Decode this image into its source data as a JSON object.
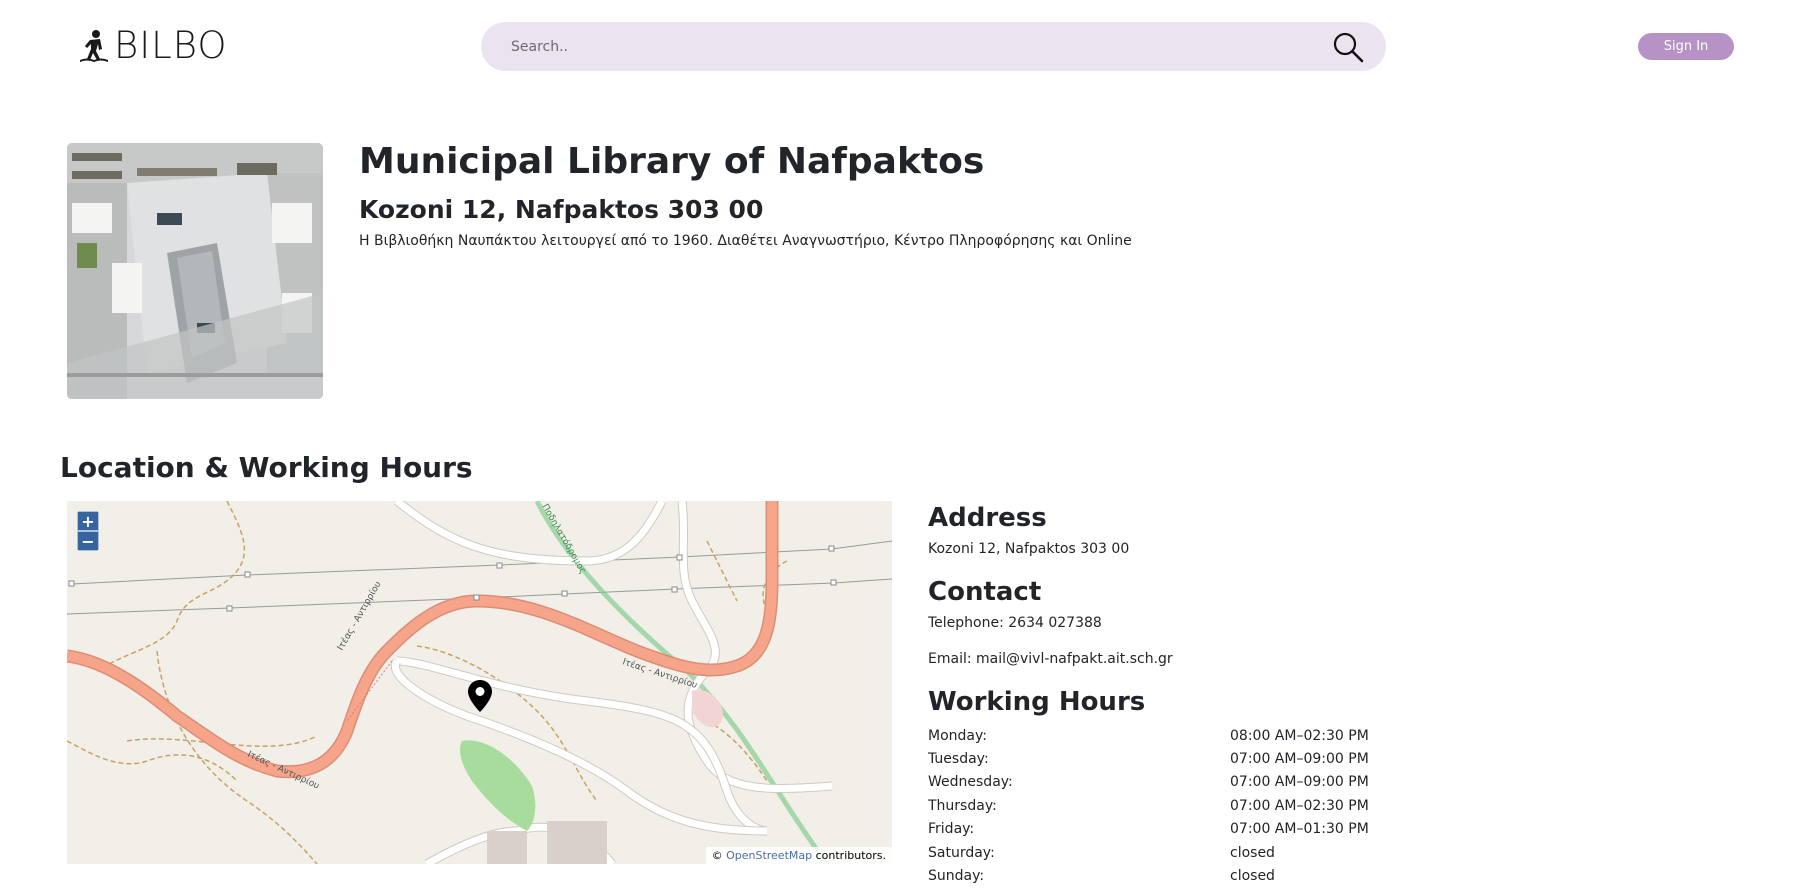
{
  "header": {
    "logo_text": "BILBO",
    "search_placeholder": "Search..",
    "sign_in_label": "Sign In"
  },
  "library": {
    "name": "Municipal Library of Nafpaktos",
    "address": "Kozoni 12, Nafpaktos 303 00",
    "description": "Η Βιβλιοθήκη Ναυπάκτου λειτουργεί από το 1960. Διαθέτει Αναγνωστήριο, Κέντρο Πληροφόρησης και Online"
  },
  "location": {
    "section_title": "Location & Working Hours",
    "map": {
      "zoom_in": "+",
      "zoom_out": "−",
      "attribution_prefix": "©",
      "attribution_link": "OpenStreetMap",
      "attribution_suffix": "contributors.",
      "road_labels": [
        "Ιτέας - Αντιρρίου",
        "Ιτέας - Αντιρρίου",
        "Ιτέας - Αντιρρίου",
        "Ποδηλατόδρομος"
      ]
    },
    "address_heading": "Address",
    "address_text": "Kozoni 12, Nafpaktos 303 00",
    "contact_heading": "Contact",
    "telephone": "Telephone: 2634 027388",
    "email": "Email: mail@vivl-nafpakt.ait.sch.gr",
    "hours_heading": "Working Hours",
    "hours": [
      {
        "day": "Monday:",
        "time": "08:00 AM–02:30 PM"
      },
      {
        "day": "Tuesday:",
        "time": "07:00 AM–09:00 PM"
      },
      {
        "day": "Wednesday:",
        "time": "07:00 AM–09:00 PM"
      },
      {
        "day": "Thursday:",
        "time": "07:00 AM–02:30 PM"
      },
      {
        "day": "Friday:",
        "time": "07:00 AM–01:30 PM"
      },
      {
        "day": "Saturday:",
        "time": "closed"
      },
      {
        "day": "Sunday:",
        "time": "closed"
      }
    ]
  },
  "colors": {
    "search_bg": "#ebe3ef",
    "sign_in_bg": "#b693c4",
    "main_road": "#f6a58a",
    "park": "#a8dc9c"
  }
}
